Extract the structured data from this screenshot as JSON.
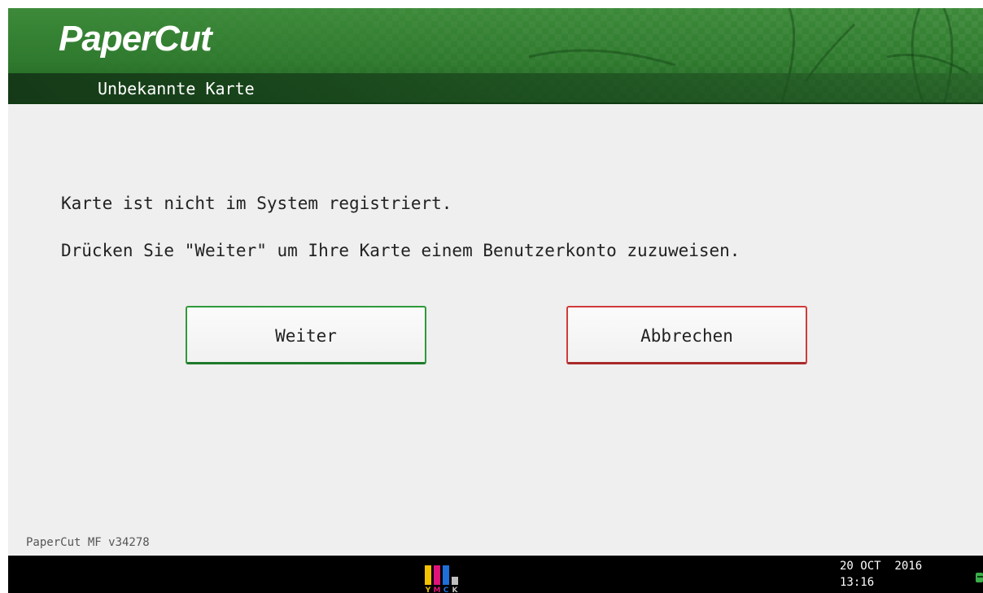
{
  "header": {
    "logo": "PaperCut",
    "title": "Unbekannte Karte"
  },
  "message": {
    "line1": "Karte ist nicht im System registriert.",
    "line2": "Drücken Sie \"Weiter\" um Ihre Karte einem Benutzerkonto zuzuweisen."
  },
  "buttons": {
    "continue_label": "Weiter",
    "cancel_label": "Abbrechen"
  },
  "footer": {
    "version": "PaperCut MF v34278"
  },
  "status_bar": {
    "date": "20 OCT  2016",
    "time": "13:16",
    "toner_letters": [
      "Y",
      "M",
      "C",
      "K"
    ],
    "toner_colors": {
      "Y": "#f2c200",
      "M": "#e0137a",
      "C": "#1e6fd9",
      "K": "#bfbfbf"
    },
    "toner_icon": "toner-level-icon",
    "side_icon": "status-indicator-icon"
  },
  "colors": {
    "brand_green": "#2f7a2e",
    "continue_border": "#2e9a3a",
    "cancel_border": "#d23a3a",
    "background": "#efefef"
  }
}
